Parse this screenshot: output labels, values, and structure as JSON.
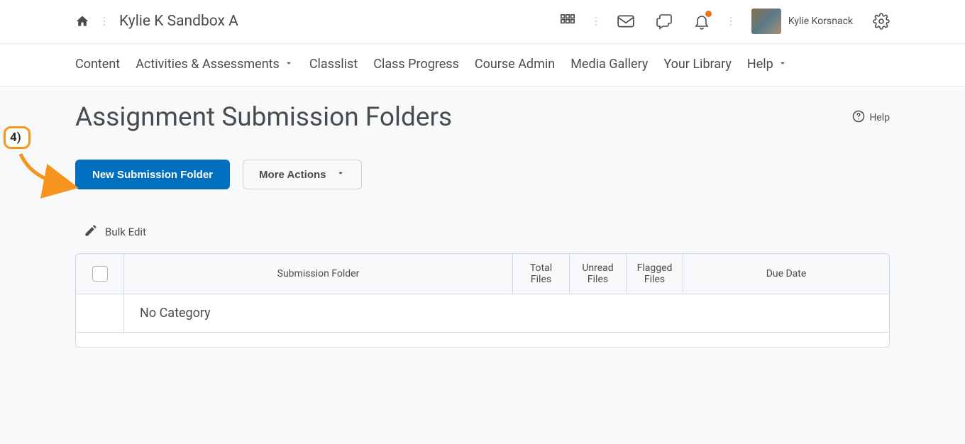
{
  "header": {
    "course_title": "Kylie K Sandbox A",
    "user_name": "Kylie Korsnack"
  },
  "nav": {
    "items": [
      {
        "label": "Content",
        "has_caret": false
      },
      {
        "label": "Activities & Assessments",
        "has_caret": true
      },
      {
        "label": "Classlist",
        "has_caret": false
      },
      {
        "label": "Class Progress",
        "has_caret": false
      },
      {
        "label": "Course Admin",
        "has_caret": false
      },
      {
        "label": "Media Gallery",
        "has_caret": false
      },
      {
        "label": "Your Library",
        "has_caret": false
      },
      {
        "label": "Help",
        "has_caret": true
      }
    ]
  },
  "page": {
    "title": "Assignment Submission Folders",
    "help_label": "Help"
  },
  "actions": {
    "primary": "New Submission Folder",
    "secondary": "More Actions",
    "bulk_edit": "Bulk Edit"
  },
  "table": {
    "headers": {
      "folder": "Submission Folder",
      "total": "Total Files",
      "unread": "Unread Files",
      "flagged": "Flagged Files",
      "due": "Due Date"
    },
    "category": "No Category"
  },
  "annotation": {
    "step": "4)"
  }
}
